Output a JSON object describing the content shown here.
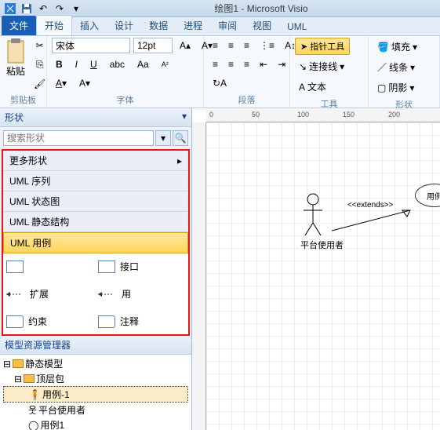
{
  "titlebar": {
    "title": "绘图1 - Microsoft Visio"
  },
  "tabs": {
    "file": "文件",
    "home": "开始",
    "insert": "插入",
    "design": "设计",
    "data": "数据",
    "process": "进程",
    "review": "审阅",
    "view": "视图",
    "uml": "UML"
  },
  "ribbon": {
    "font_name": "宋体",
    "font_size": "12pt",
    "clipboard": {
      "paste": "粘贴",
      "label": "剪贴板"
    },
    "font": {
      "label": "字体"
    },
    "paragraph": {
      "label": "段落"
    },
    "tools": {
      "pointer": "指针工具",
      "connector": "连接线",
      "text": "文本",
      "label": "工具"
    },
    "shapes": {
      "fill": "填充",
      "line": "线条",
      "shadow": "阴影",
      "label": "形状"
    }
  },
  "shapes_pane": {
    "title": "形状",
    "search_placeholder": "搜索形状",
    "more": "更多形状",
    "cats": [
      "UML 序列",
      "UML 状态图",
      "UML 静态结构",
      "UML 用例"
    ],
    "items": {
      "ext": "扩展",
      "use": "用",
      "constraint": "约束",
      "note": "注释",
      "interface": "接口"
    },
    "model_mgr": "模型资源管理器",
    "tree": {
      "static_model": "静态模型",
      "top_pkg": "顶层包",
      "usecase1": "用例-1",
      "actor": "平台使用者",
      "uc1": "用例1"
    }
  },
  "canvas": {
    "actor_label": "平台使用者",
    "extends": "<<extends>>",
    "usecase": "用例"
  },
  "ruler_ticks": [
    "0",
    "50",
    "100",
    "150",
    "200"
  ]
}
